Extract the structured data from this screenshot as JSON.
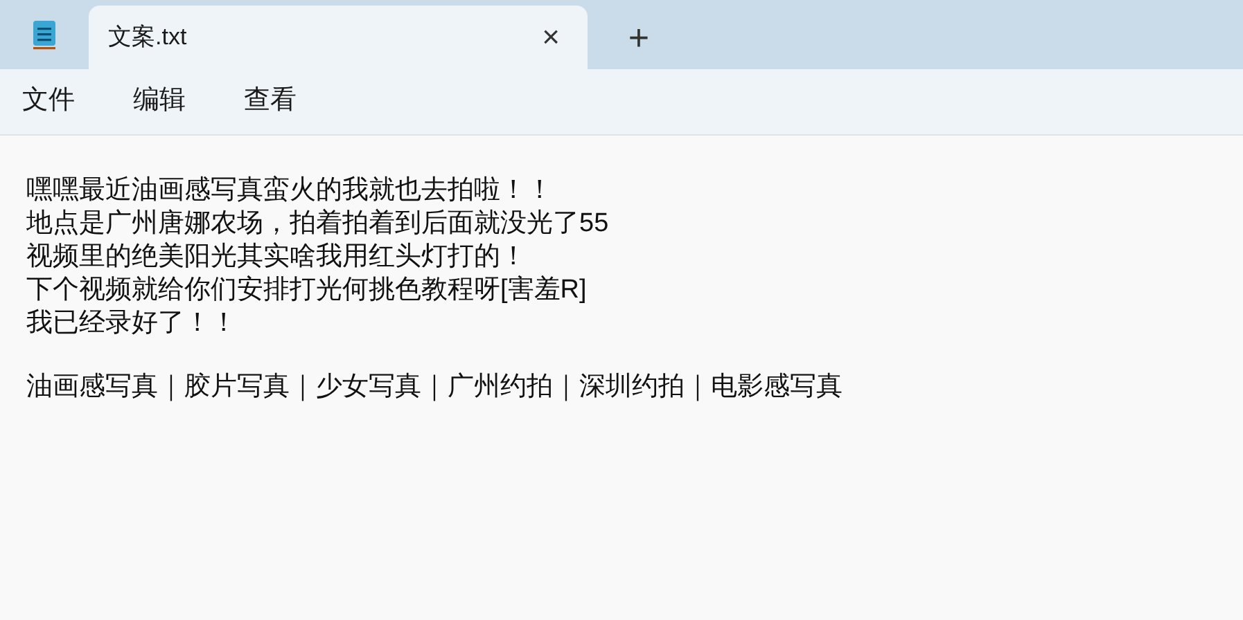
{
  "tabs": [
    {
      "title": "文案.txt",
      "selected": true,
      "close": "×"
    }
  ],
  "new_tab": "+",
  "menu": [
    "文件",
    "编辑",
    "查看"
  ],
  "document": {
    "paragraphs": [
      [
        "嘿嘿最近油画感写真蛮火的我就也去拍啦！！",
        "地点是广州唐娜农场，拍着拍着到后面就没光了55",
        "视频里的绝美阳光其实啥我用红头灯打的！",
        "下个视频就给你们安排打光何挑色教程呀[害羞R]",
        "我已经录好了！！"
      ],
      [
        "油画感写真｜胶片写真｜少女写真｜广州约拍｜深圳约拍｜电影感写真"
      ]
    ]
  }
}
